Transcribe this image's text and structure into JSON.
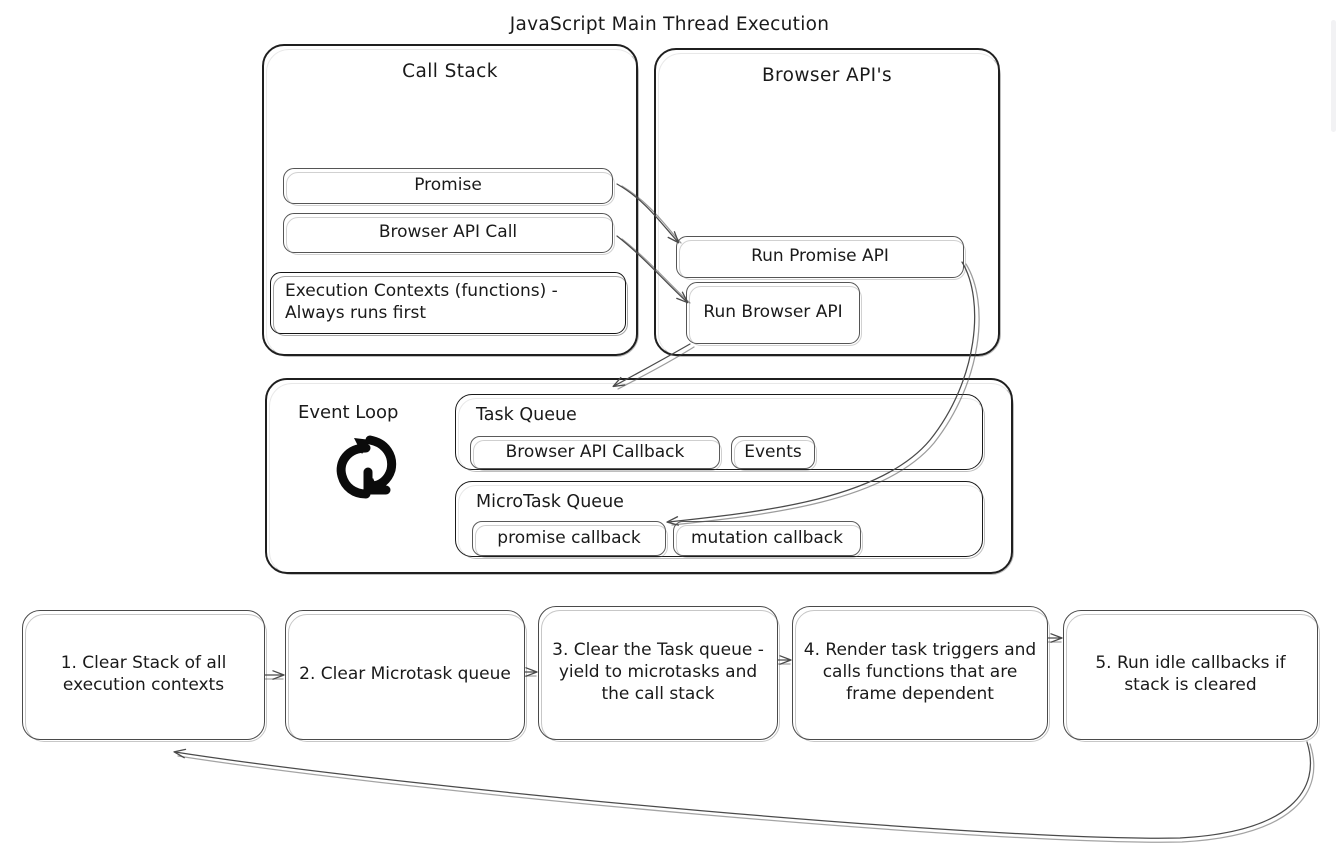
{
  "diagram": {
    "title": "JavaScript Main Thread Execution",
    "type": "flow-diagram"
  },
  "call_stack": {
    "title": "Call Stack",
    "items": [
      {
        "label": "Promise"
      },
      {
        "label": "Browser API Call"
      },
      {
        "label": "Execution Contexts (functions) - Always runs first"
      }
    ]
  },
  "browser_apis": {
    "title": "Browser API's",
    "items": [
      {
        "label": "Run Promise API"
      },
      {
        "label": "Run Browser API"
      }
    ]
  },
  "event_loop": {
    "title": "Event Loop",
    "icon": "loop-arrows-icon",
    "queues": [
      {
        "title": "Task Queue",
        "items": [
          "Browser API Callback",
          "Events"
        ]
      },
      {
        "title": "MicroTask Queue",
        "items": [
          "promise callback",
          "mutation callback"
        ]
      }
    ]
  },
  "steps": [
    {
      "label": "1. Clear Stack of all execution contexts"
    },
    {
      "label": "2. Clear Microtask queue"
    },
    {
      "label": "3. Clear the Task queue - yield to microtasks and the call stack"
    },
    {
      "label": "4. Render task triggers and calls functions that are frame dependent"
    },
    {
      "label": "5. Run idle callbacks if stack is cleared"
    }
  ],
  "colors": {
    "background": "#ffffff",
    "stroke": "#1f1f1f",
    "stroke_light": "#5a5a5a",
    "text": "#1a1a1a"
  }
}
